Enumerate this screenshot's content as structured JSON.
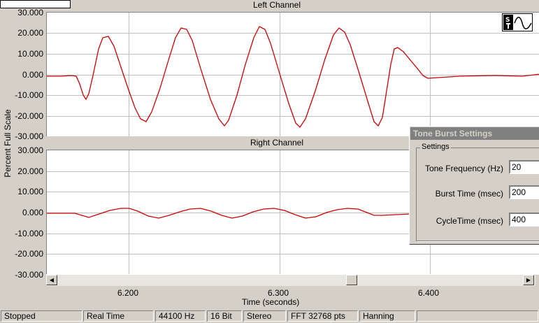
{
  "left_chart": {
    "title": "Left Channel",
    "y_ticks": [
      "30.000",
      "20.000",
      "10.000",
      "0.000",
      "-10.000",
      "-20.000",
      "-30.000"
    ]
  },
  "right_chart": {
    "title": "Right Channel",
    "y_ticks": [
      "30.000",
      "20.000",
      "10.000",
      "0.000",
      "-10.000",
      "-20.000",
      "-30.000"
    ]
  },
  "y_axis_title": "Percent Full Scale",
  "x_axis": {
    "title": "Time (seconds)",
    "ticks": [
      "6.200",
      "6.300",
      "6.400"
    ]
  },
  "icons": {
    "signal_tool": "sine-settings-icon",
    "scroll_left": "arrow-left-icon",
    "scroll_right": "arrow-right-icon"
  },
  "colors": {
    "trace": "#cc0000",
    "grid": "#c0c0c0",
    "dialog_title_bg": "#808080"
  },
  "dialog": {
    "title": "Tone Burst Settings",
    "group_label": "Settings",
    "fields": [
      {
        "label": "Tone Frequency (Hz)",
        "value": "20"
      },
      {
        "label": "Burst Time (msec)",
        "value": "200"
      },
      {
        "label": "CycleTime (msec)",
        "value": "400"
      }
    ]
  },
  "status_bar": [
    "Stopped",
    "Real Time",
    "44100 Hz",
    "16 Bit",
    "Stereo",
    "FFT 32768 pts",
    "Hanning"
  ]
}
